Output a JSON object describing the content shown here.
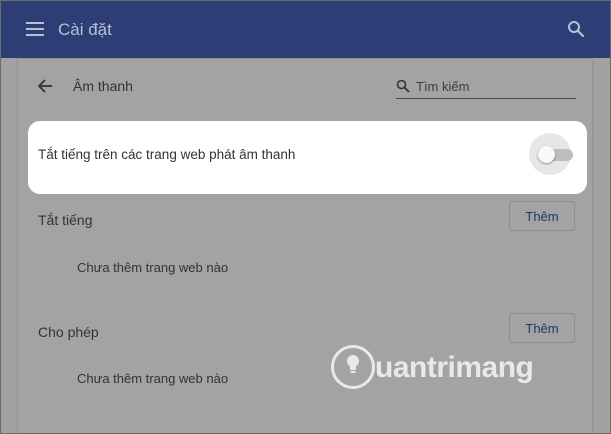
{
  "header": {
    "title": "Cài đặt",
    "menu_icon": "hamburger-menu-icon",
    "search_icon": "search-icon",
    "background_color": "#2c3e75"
  },
  "page": {
    "title": "Âm thanh",
    "back_icon": "arrow-left-icon",
    "search": {
      "placeholder": "Tìm kiếm",
      "value": ""
    }
  },
  "mute_setting": {
    "label": "Tắt tiếng trên các trang web phát âm thanh",
    "enabled": false
  },
  "sections": [
    {
      "title": "Tắt tiếng",
      "add_label": "Thêm",
      "empty_text": "Chưa thêm trang web nào"
    },
    {
      "title": "Cho phép",
      "add_label": "Thêm",
      "empty_text": "Chưa thêm trang web nào"
    }
  ],
  "watermark": {
    "text": "uantrimang",
    "icon": "lightbulb-logo-icon"
  },
  "colors": {
    "accent_text": "#22346e",
    "overlay": "#a2a2a2",
    "highlight": "#ffffff"
  }
}
